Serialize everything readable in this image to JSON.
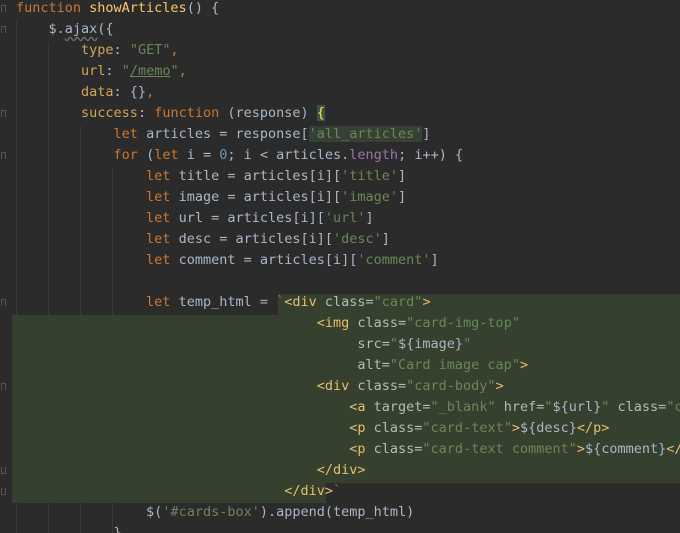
{
  "editor": {
    "language": "javascript",
    "lines": [
      {
        "tokens": [
          {
            "t": "function ",
            "c": "kw"
          },
          {
            "t": "showArticles",
            "c": "fn"
          },
          {
            "t": "() {",
            "c": ""
          }
        ]
      },
      {
        "tokens": [
          {
            "t": "    $.",
            "c": ""
          },
          {
            "t": "ajax",
            "c": "u-wave"
          },
          {
            "t": "({",
            "c": ""
          }
        ]
      },
      {
        "tokens": [
          {
            "t": "        ",
            "c": ""
          },
          {
            "t": "type",
            "c": "objkey"
          },
          {
            "t": ": ",
            "c": ""
          },
          {
            "t": "\"GET\"",
            "c": "str"
          },
          {
            "t": ",",
            "c": "kw"
          }
        ]
      },
      {
        "tokens": [
          {
            "t": "        ",
            "c": ""
          },
          {
            "t": "url",
            "c": "objkey"
          },
          {
            "t": ": ",
            "c": ""
          },
          {
            "t": "\"",
            "c": "str"
          },
          {
            "t": "/memo",
            "c": "str u-line"
          },
          {
            "t": "\"",
            "c": "str"
          },
          {
            "t": ",",
            "c": "kw"
          }
        ]
      },
      {
        "tokens": [
          {
            "t": "        ",
            "c": ""
          },
          {
            "t": "data",
            "c": "objkey"
          },
          {
            "t": ": {}",
            "c": ""
          },
          {
            "t": ",",
            "c": "kw"
          }
        ]
      },
      {
        "tokens": [
          {
            "t": "        ",
            "c": ""
          },
          {
            "t": "success",
            "c": "objkey"
          },
          {
            "t": ": ",
            "c": ""
          },
          {
            "t": "function ",
            "c": "kw"
          },
          {
            "t": "(response) ",
            "c": ""
          },
          {
            "t": "{",
            "c": "brace-hl"
          }
        ]
      },
      {
        "tokens": [
          {
            "t": "            ",
            "c": ""
          },
          {
            "t": "let ",
            "c": "kw"
          },
          {
            "t": "articles = response[",
            "c": ""
          },
          {
            "t": "'all_articles'",
            "c": "str sel-str"
          },
          {
            "t": "]",
            "c": ""
          }
        ]
      },
      {
        "tokens": [
          {
            "t": "            ",
            "c": ""
          },
          {
            "t": "for ",
            "c": "kw"
          },
          {
            "t": "(",
            "c": ""
          },
          {
            "t": "let ",
            "c": "kw"
          },
          {
            "t": "i = ",
            "c": ""
          },
          {
            "t": "0",
            "c": "num"
          },
          {
            "t": "; i < articles.",
            "c": ""
          },
          {
            "t": "length",
            "c": "prop"
          },
          {
            "t": "; i++) {",
            "c": ""
          }
        ]
      },
      {
        "tokens": [
          {
            "t": "                ",
            "c": ""
          },
          {
            "t": "let ",
            "c": "kw"
          },
          {
            "t": "title = articles[i][",
            "c": ""
          },
          {
            "t": "'title'",
            "c": "str"
          },
          {
            "t": "]",
            "c": ""
          }
        ]
      },
      {
        "tokens": [
          {
            "t": "                ",
            "c": ""
          },
          {
            "t": "let ",
            "c": "kw"
          },
          {
            "t": "image = articles[i][",
            "c": ""
          },
          {
            "t": "'image'",
            "c": "str"
          },
          {
            "t": "]",
            "c": ""
          }
        ]
      },
      {
        "tokens": [
          {
            "t": "                ",
            "c": ""
          },
          {
            "t": "let ",
            "c": "kw"
          },
          {
            "t": "url = articles[i][",
            "c": ""
          },
          {
            "t": "'url'",
            "c": "str"
          },
          {
            "t": "]",
            "c": ""
          }
        ]
      },
      {
        "tokens": [
          {
            "t": "                ",
            "c": ""
          },
          {
            "t": "let ",
            "c": "kw"
          },
          {
            "t": "desc = articles[i][",
            "c": ""
          },
          {
            "t": "'desc'",
            "c": "str"
          },
          {
            "t": "]",
            "c": ""
          }
        ]
      },
      {
        "tokens": [
          {
            "t": "                ",
            "c": ""
          },
          {
            "t": "let ",
            "c": "kw"
          },
          {
            "t": "comment = articles[i][",
            "c": ""
          },
          {
            "t": "'comment'",
            "c": "str"
          },
          {
            "t": "]",
            "c": ""
          }
        ]
      },
      {
        "tokens": [
          {
            "t": "",
            "c": ""
          }
        ]
      },
      {
        "tokens": [
          {
            "t": "                ",
            "c": ""
          },
          {
            "t": "let ",
            "c": "kw"
          },
          {
            "t": "temp_html = ",
            "c": ""
          },
          {
            "t": "`",
            "c": "str"
          },
          {
            "t": "<div ",
            "c": "tag"
          },
          {
            "t": "class=",
            "c": "attr"
          },
          {
            "t": "\"card\"",
            "c": "str"
          },
          {
            "t": ">",
            "c": "tag"
          }
        ]
      },
      {
        "tokens": [
          {
            "t": "                                     ",
            "c": ""
          },
          {
            "t": "<img ",
            "c": "tag"
          },
          {
            "t": "class=",
            "c": "attr"
          },
          {
            "t": "\"card-img-top\"",
            "c": "str"
          }
        ]
      },
      {
        "tokens": [
          {
            "t": "                                          ",
            "c": ""
          },
          {
            "t": "src=",
            "c": "attr"
          },
          {
            "t": "\"",
            "c": "str"
          },
          {
            "t": "${image}",
            "c": "tpl"
          },
          {
            "t": "\"",
            "c": "str"
          }
        ]
      },
      {
        "tokens": [
          {
            "t": "                                          ",
            "c": ""
          },
          {
            "t": "alt=",
            "c": "attr"
          },
          {
            "t": "\"Card image cap\"",
            "c": "str"
          },
          {
            "t": ">",
            "c": "tag"
          }
        ]
      },
      {
        "tokens": [
          {
            "t": "                                     ",
            "c": ""
          },
          {
            "t": "<div ",
            "c": "tag"
          },
          {
            "t": "class=",
            "c": "attr"
          },
          {
            "t": "\"card-body\"",
            "c": "str"
          },
          {
            "t": ">",
            "c": "tag"
          }
        ]
      },
      {
        "tokens": [
          {
            "t": "                                         ",
            "c": ""
          },
          {
            "t": "<a ",
            "c": "tag"
          },
          {
            "t": "target=",
            "c": "attr"
          },
          {
            "t": "\"_blank\" ",
            "c": "str"
          },
          {
            "t": "href=",
            "c": "attr"
          },
          {
            "t": "\"",
            "c": "str"
          },
          {
            "t": "${url}",
            "c": "tpl"
          },
          {
            "t": "\" ",
            "c": "str"
          },
          {
            "t": "class=",
            "c": "attr"
          },
          {
            "t": "\"car",
            "c": "str"
          }
        ]
      },
      {
        "tokens": [
          {
            "t": "                                         ",
            "c": ""
          },
          {
            "t": "<p ",
            "c": "tag"
          },
          {
            "t": "class=",
            "c": "attr"
          },
          {
            "t": "\"card-text\"",
            "c": "str"
          },
          {
            "t": ">",
            "c": "tag"
          },
          {
            "t": "${desc}",
            "c": "tpl"
          },
          {
            "t": "</p>",
            "c": "tag"
          }
        ]
      },
      {
        "tokens": [
          {
            "t": "                                         ",
            "c": ""
          },
          {
            "t": "<p ",
            "c": "tag"
          },
          {
            "t": "class=",
            "c": "attr"
          },
          {
            "t": "\"card-text comment\"",
            "c": "str"
          },
          {
            "t": ">",
            "c": "tag"
          },
          {
            "t": "${comment}",
            "c": "tpl"
          },
          {
            "t": "</p>",
            "c": "tag"
          }
        ]
      },
      {
        "tokens": [
          {
            "t": "                                     ",
            "c": ""
          },
          {
            "t": "</div>",
            "c": "tag"
          }
        ]
      },
      {
        "tokens": [
          {
            "t": "                                 ",
            "c": ""
          },
          {
            "t": "</div>",
            "c": "tag"
          },
          {
            "t": "`",
            "c": "str"
          }
        ]
      },
      {
        "tokens": [
          {
            "t": "                ",
            "c": ""
          },
          {
            "t": "$(",
            "c": ""
          },
          {
            "t": "'#cards-box'",
            "c": "str"
          },
          {
            "t": ").",
            "c": ""
          },
          {
            "t": "append",
            "c": ""
          },
          {
            "t": "(temp_html)",
            "c": ""
          }
        ]
      },
      {
        "tokens": [
          {
            "t": "            }",
            "c": ""
          }
        ]
      }
    ]
  }
}
